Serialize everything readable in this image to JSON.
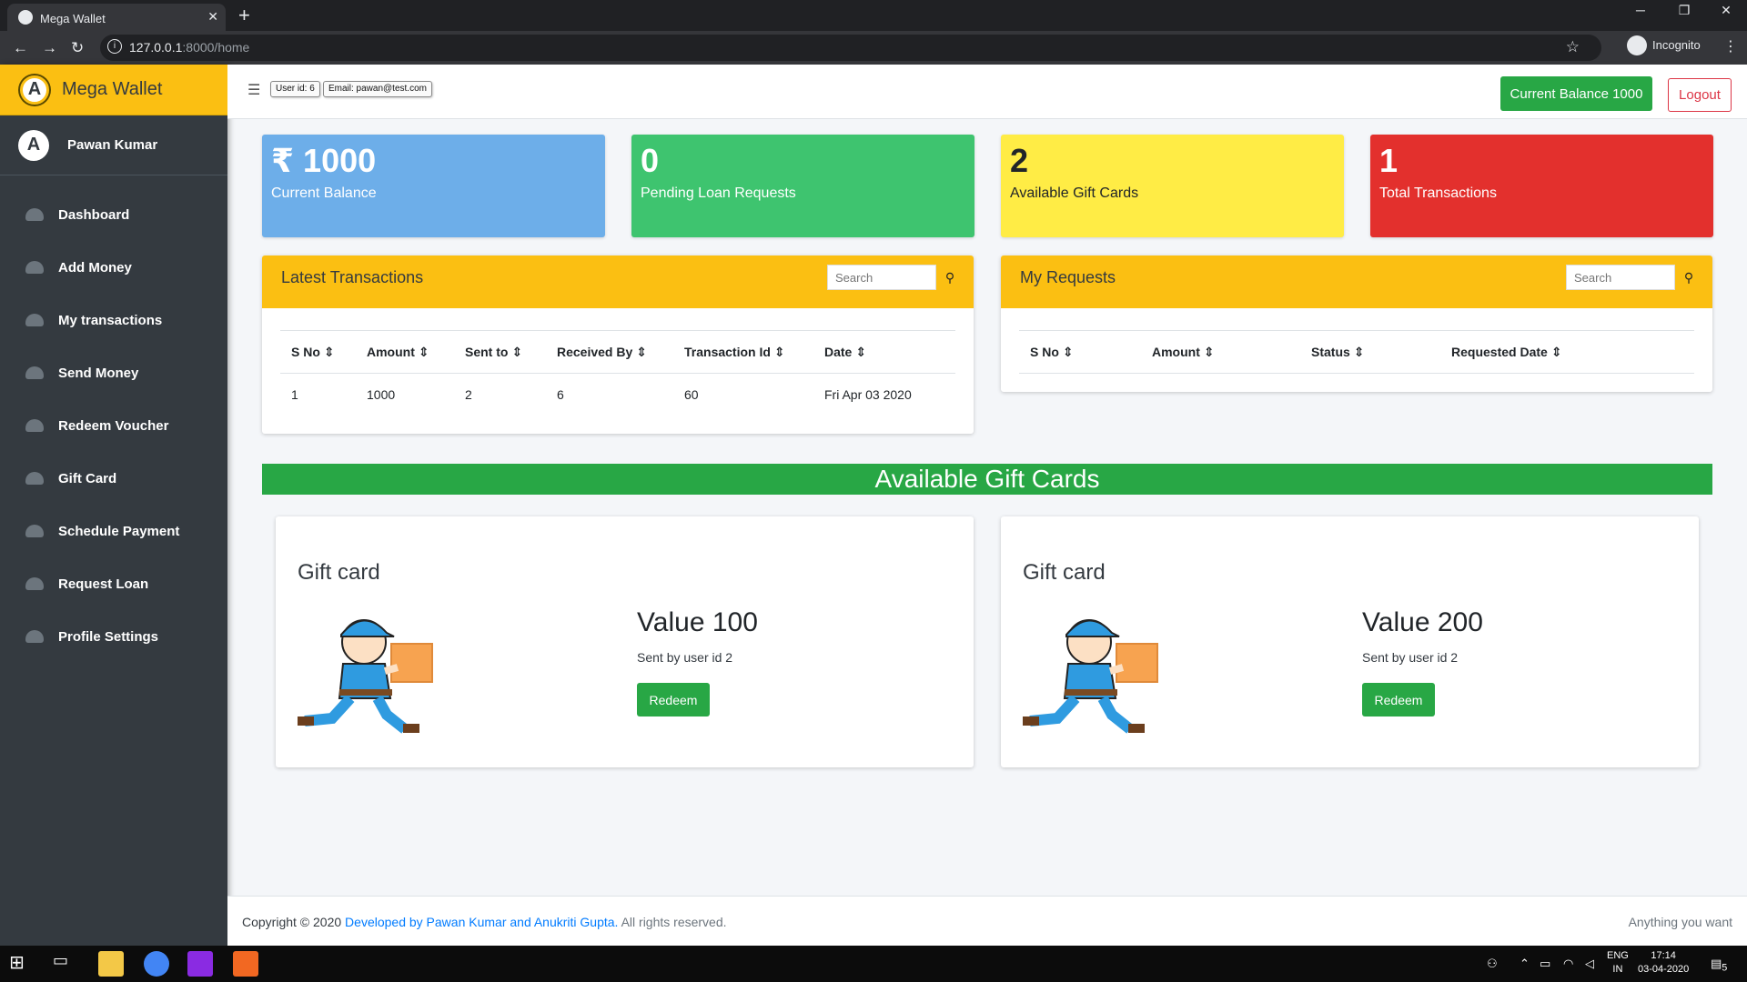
{
  "browser": {
    "tab_title": "Mega Wallet",
    "url_host": "127.0.0.1",
    "url_rest": ":8000/home",
    "profile": "Incognito"
  },
  "sidebar": {
    "brand": "Mega Wallet",
    "user_name": "Pawan Kumar",
    "items": [
      {
        "label": "Dashboard"
      },
      {
        "label": "Add Money"
      },
      {
        "label": "My transactions"
      },
      {
        "label": "Send Money"
      },
      {
        "label": "Redeem Voucher"
      },
      {
        "label": "Gift Card"
      },
      {
        "label": "Schedule Payment"
      },
      {
        "label": "Request Loan"
      },
      {
        "label": "Profile Settings"
      }
    ]
  },
  "topbar": {
    "user_id": "User id: 6",
    "email": "Email: pawan@test.com",
    "balance_btn": "Current Balance 1000",
    "logout": "Logout"
  },
  "stats": [
    {
      "value": "₹ 1000",
      "label": "Current Balance",
      "color": "#6daee9"
    },
    {
      "value": "0",
      "label": "Pending Loan Requests",
      "color": "#3ec46f"
    },
    {
      "value": "2",
      "label": "Available Gift Cards",
      "color": "#ffec45"
    },
    {
      "value": "1",
      "label": "Total Transactions",
      "color": "#e3302d"
    }
  ],
  "transactions": {
    "title": "Latest Transactions",
    "search_placeholder": "Search",
    "headers": [
      "S No",
      "Amount",
      "Sent to",
      "Received By",
      "Transaction Id",
      "Date"
    ],
    "rows": [
      [
        "1",
        "1000",
        "2",
        "6",
        "60",
        "Fri Apr 03 2020"
      ]
    ]
  },
  "requests": {
    "title": "My Requests",
    "search_placeholder": "Search",
    "headers": [
      "S No",
      "Amount",
      "Status",
      "Requested Date"
    ]
  },
  "gift_section": {
    "title": "Available Gift Cards",
    "cards": [
      {
        "title": "Gift card",
        "value": "Value 100",
        "sender": "Sent by user id 2",
        "button": "Redeem"
      },
      {
        "title": "Gift card",
        "value": "Value 200",
        "sender": "Sent by user id 2",
        "button": "Redeem"
      }
    ]
  },
  "footer": {
    "copyright": "Copyright © 2020",
    "developer": "Developed by Pawan Kumar and Anukriti Gupta.",
    "rights": "All rights reserved.",
    "tagline": "Anything you want"
  },
  "taskbar": {
    "lang_top": "ENG",
    "lang_bottom": "IN",
    "time": "17:14",
    "date": "03-04-2020",
    "notifications": "5"
  },
  "colors": {
    "accent_yellow": "#fbbf12",
    "sidebar_bg": "#343a40",
    "success": "#28a745",
    "danger": "#dc3545"
  }
}
